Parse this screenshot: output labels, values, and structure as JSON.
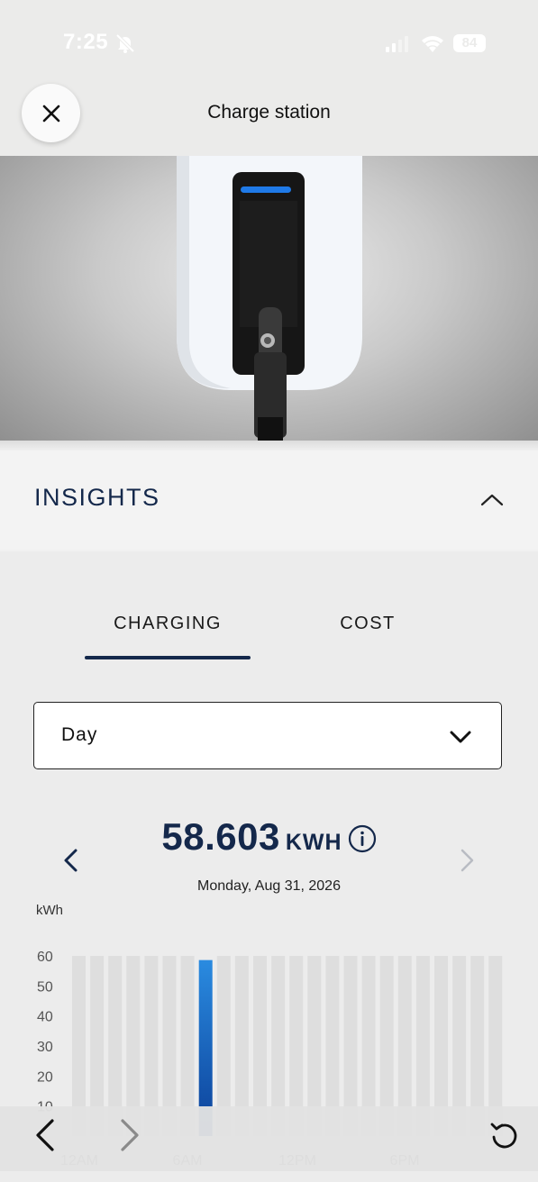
{
  "status": {
    "time": "7:25",
    "battery": "84"
  },
  "header": {
    "title": "Charge station"
  },
  "insights": {
    "title": "INSIGHTS"
  },
  "tabs": [
    {
      "label": "CHARGING",
      "selected": true
    },
    {
      "label": "COST",
      "selected": false
    }
  ],
  "period": {
    "selected": "Day"
  },
  "summary": {
    "total": "58.603",
    "unit": "KWH",
    "date": "Monday, Aug 31, 2026"
  },
  "colors": {
    "navy": "#14284b",
    "bar_highlight": "#1d6ec4",
    "bar_default": "#dedede"
  },
  "chart_data": {
    "type": "bar",
    "ylabel": "kWh",
    "ylim": [
      0,
      60
    ],
    "yticks": [
      10,
      20,
      30,
      40,
      50,
      60
    ],
    "xticklabels": [
      "12AM",
      "6AM",
      "12PM",
      "6PM"
    ],
    "categories": [
      "0",
      "1",
      "2",
      "3",
      "4",
      "5",
      "6",
      "7",
      "8",
      "9",
      "10",
      "11",
      "12",
      "13",
      "14",
      "15",
      "16",
      "17",
      "18",
      "19",
      "20",
      "21",
      "22",
      "23"
    ],
    "values": [
      0,
      0,
      0,
      0,
      0,
      0,
      0,
      58.603,
      0,
      0,
      0,
      0,
      0,
      0,
      0,
      0,
      0,
      0,
      0,
      0,
      0,
      0,
      0,
      0
    ],
    "highlight_index": 7
  }
}
